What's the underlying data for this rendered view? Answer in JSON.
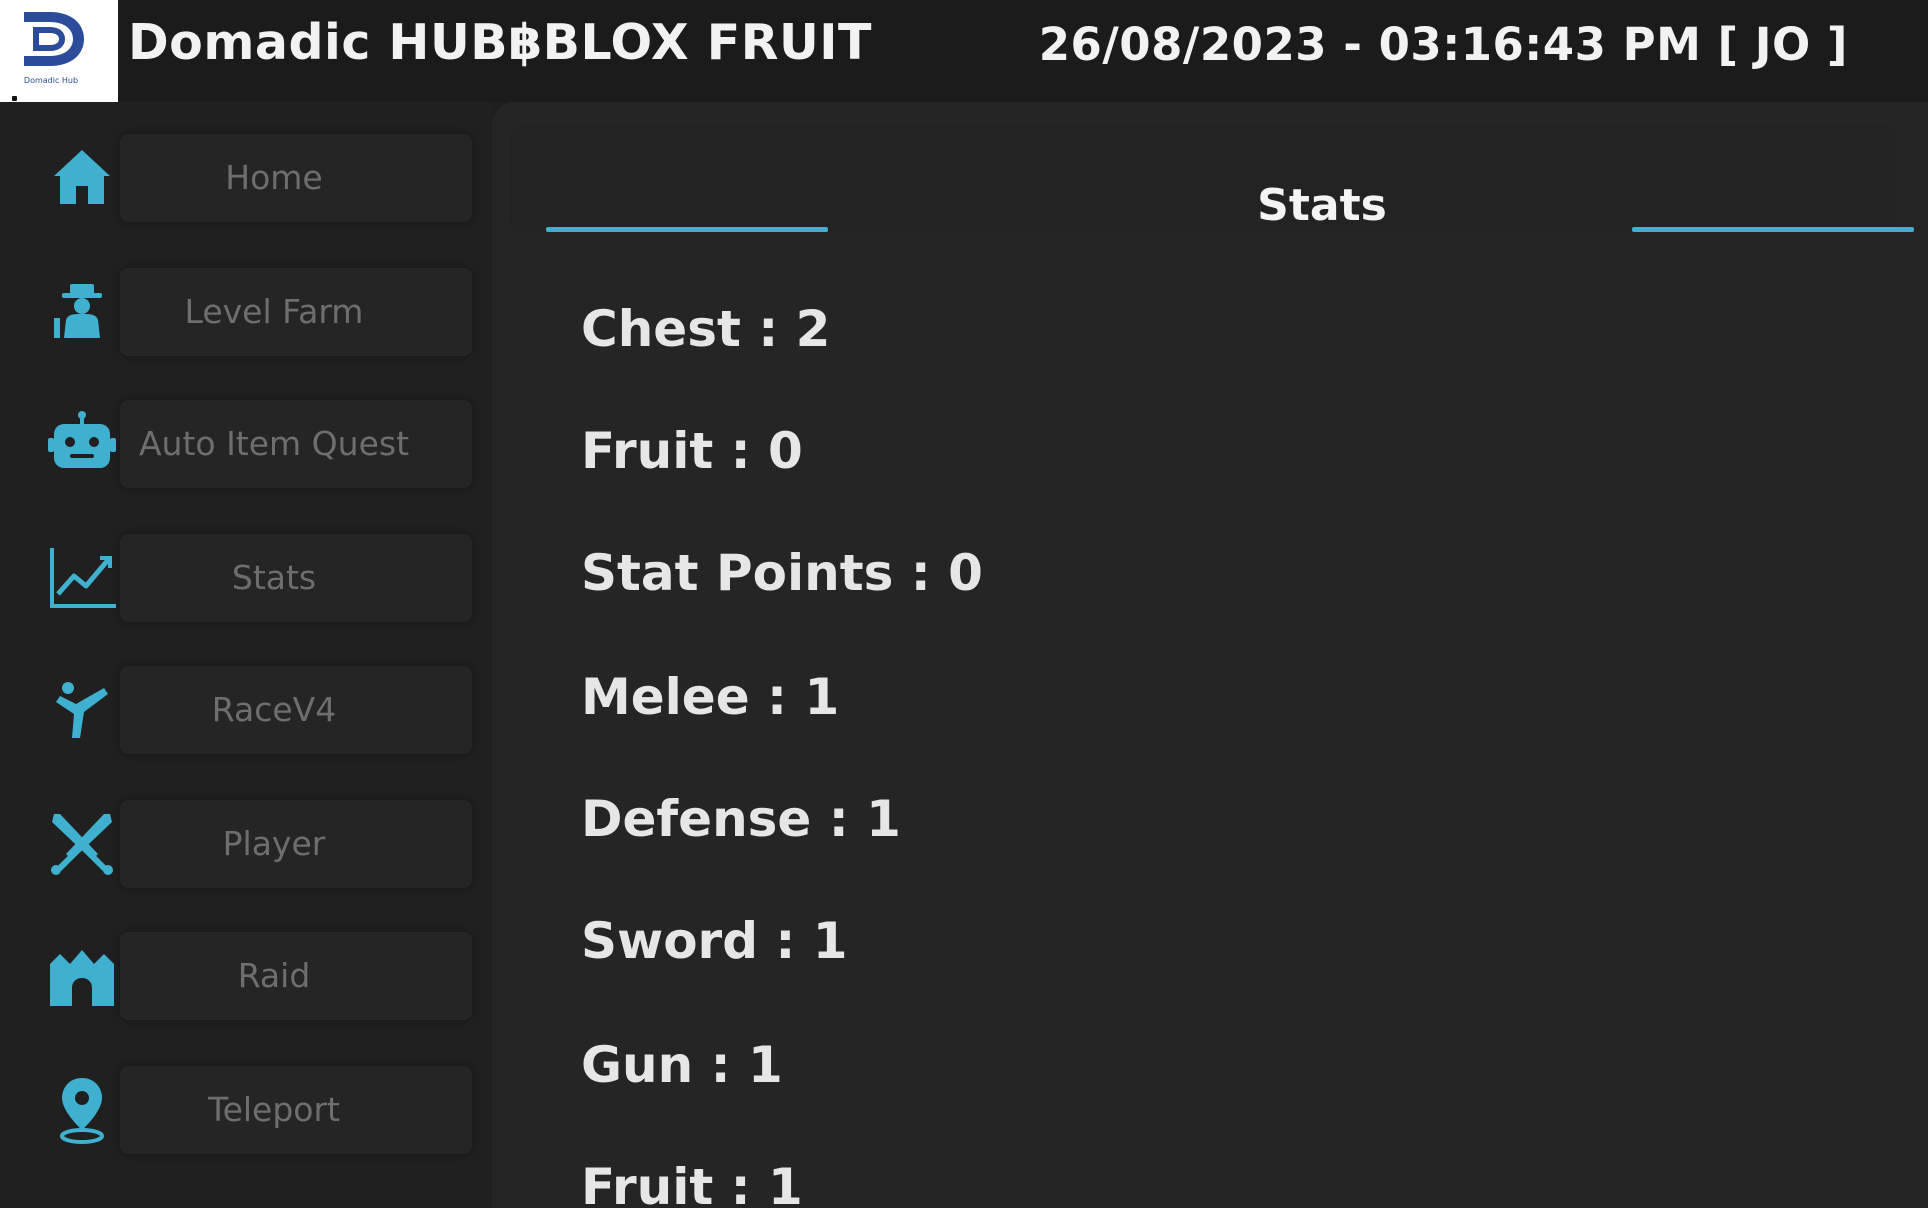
{
  "app": {
    "logo_text": "Domadic Hub",
    "title": "Domadic HUB฿BLOX FRUIT",
    "datetime": "26/08/2023 - 03:16:43 PM [ JO ]"
  },
  "sidebar": {
    "items": [
      {
        "label": "Home",
        "icon": "home-icon"
      },
      {
        "label": "Level Farm",
        "icon": "farmer-icon"
      },
      {
        "label": "Auto Item Quest",
        "icon": "robot-icon"
      },
      {
        "label": "Stats",
        "icon": "chart-line-icon"
      },
      {
        "label": "RaceV4",
        "icon": "martial-arts-icon"
      },
      {
        "label": "Player",
        "icon": "crossed-swords-icon"
      },
      {
        "label": "Raid",
        "icon": "castle-icon"
      },
      {
        "label": "Teleport",
        "icon": "map-pin-icon"
      }
    ]
  },
  "main": {
    "section_title": "Stats",
    "stats": [
      "Chest : 2",
      "Fruit : 0",
      "Stat Points : 0",
      "Melee : 1",
      "Defense : 1",
      "Sword : 1",
      "Gun : 1",
      "Fruit : 1"
    ]
  },
  "colors": {
    "accent": "#3fb0cf",
    "background": "#1e1e1e",
    "panel": "#252525",
    "nav_label": "#6e6e6e"
  }
}
